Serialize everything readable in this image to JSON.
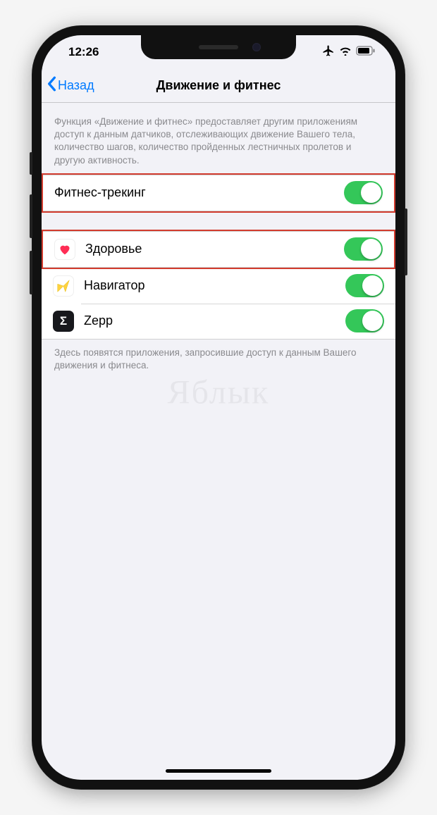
{
  "status": {
    "time": "12:26"
  },
  "nav": {
    "back_label": "Назад",
    "title": "Движение и фитнес"
  },
  "section1": {
    "header": "Функция «Движение и фитнес» предоставляет другим приложениям доступ к данным датчиков, отслеживающих движение Вашего тела, количество шагов, количество пройденных лестничных пролетов и другую активность.",
    "fitness_tracking": {
      "label": "Фитнес-трекинг",
      "on": true
    }
  },
  "section2": {
    "apps": [
      {
        "name": "Здоровье",
        "icon": "health",
        "on": true
      },
      {
        "name": "Навигатор",
        "icon": "navigator",
        "on": true
      },
      {
        "name": "Zepp",
        "icon": "zepp",
        "on": true
      }
    ],
    "footer": "Здесь появятся приложения, запросившие доступ к данным Вашего движения и фитнеса."
  },
  "watermark": "Яблык"
}
